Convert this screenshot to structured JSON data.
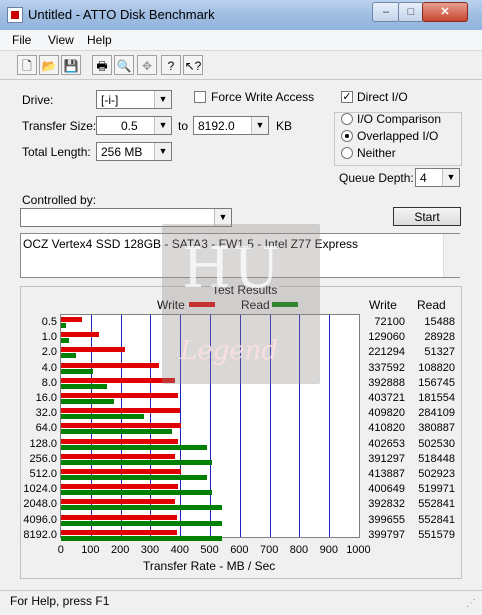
{
  "window": {
    "title": "Untitled - ATTO Disk Benchmark",
    "min": "–",
    "max": "□",
    "close": "✕"
  },
  "menu": [
    "File",
    "View",
    "Help"
  ],
  "toolbar": [
    "new-icon",
    "open-icon",
    "save-icon",
    "print-icon",
    "print-preview-icon",
    "move-icon",
    "help-icon",
    "context-help-icon"
  ],
  "form": {
    "drive_label": "Drive:",
    "drive_value": "[-i-]",
    "force_write_label": "Force Write Access",
    "direct_io_label": "Direct I/O",
    "direct_io_checked": true,
    "transfer_size_label": "Transfer Size:",
    "transfer_from": "0.5",
    "to_label": "to",
    "transfer_to": "8192.0",
    "kb_label": "KB",
    "total_length_label": "Total Length:",
    "total_length": "256 MB",
    "io_comparison": "I/O Comparison",
    "overlapped_io": "Overlapped I/O",
    "neither": "Neither",
    "queue_depth_label": "Queue Depth:",
    "queue_depth": "4",
    "controlled_by_label": "Controlled by:",
    "controlled_by_value": "",
    "start_label": "Start",
    "description": "OCZ Vertex4 SSD 128GB - SATA3 - FW1.5 - Intel Z77 Express"
  },
  "watermark": {
    "top": "HU",
    "bottom": "Legend"
  },
  "results": {
    "title": "Test Results",
    "write_legend": "Write",
    "read_legend": "Read",
    "write_header": "Write",
    "read_header": "Read"
  },
  "chart_data": {
    "type": "bar",
    "orientation": "horizontal",
    "title": "Test Results",
    "xlabel": "Transfer Rate - MB / Sec",
    "xlim": [
      0,
      1000
    ],
    "xticks": [
      "0",
      "100",
      "200",
      "300",
      "400",
      "500",
      "600",
      "700",
      "800",
      "900",
      "1000"
    ],
    "categories": [
      "0.5",
      "1.0",
      "2.0",
      "4.0",
      "8.0",
      "16.0",
      "32.0",
      "64.0",
      "128.0",
      "256.0",
      "512.0",
      "1024.0",
      "2048.0",
      "4096.0",
      "8192.0"
    ],
    "series": [
      {
        "name": "Write",
        "color": "#e00000",
        "values": [
          72100,
          129060,
          221294,
          337592,
          392888,
          403721,
          409820,
          410820,
          402653,
          391297,
          413887,
          400649,
          392832,
          399655,
          399797
        ]
      },
      {
        "name": "Read",
        "color": "#008000",
        "values": [
          15488,
          28928,
          51327,
          108820,
          156745,
          181554,
          284109,
          380887,
          502530,
          518448,
          502923,
          519971,
          552841,
          552841,
          551579
        ]
      }
    ],
    "value_unit": "KB/s",
    "grid": true
  },
  "status": {
    "text": "For Help, press F1"
  }
}
